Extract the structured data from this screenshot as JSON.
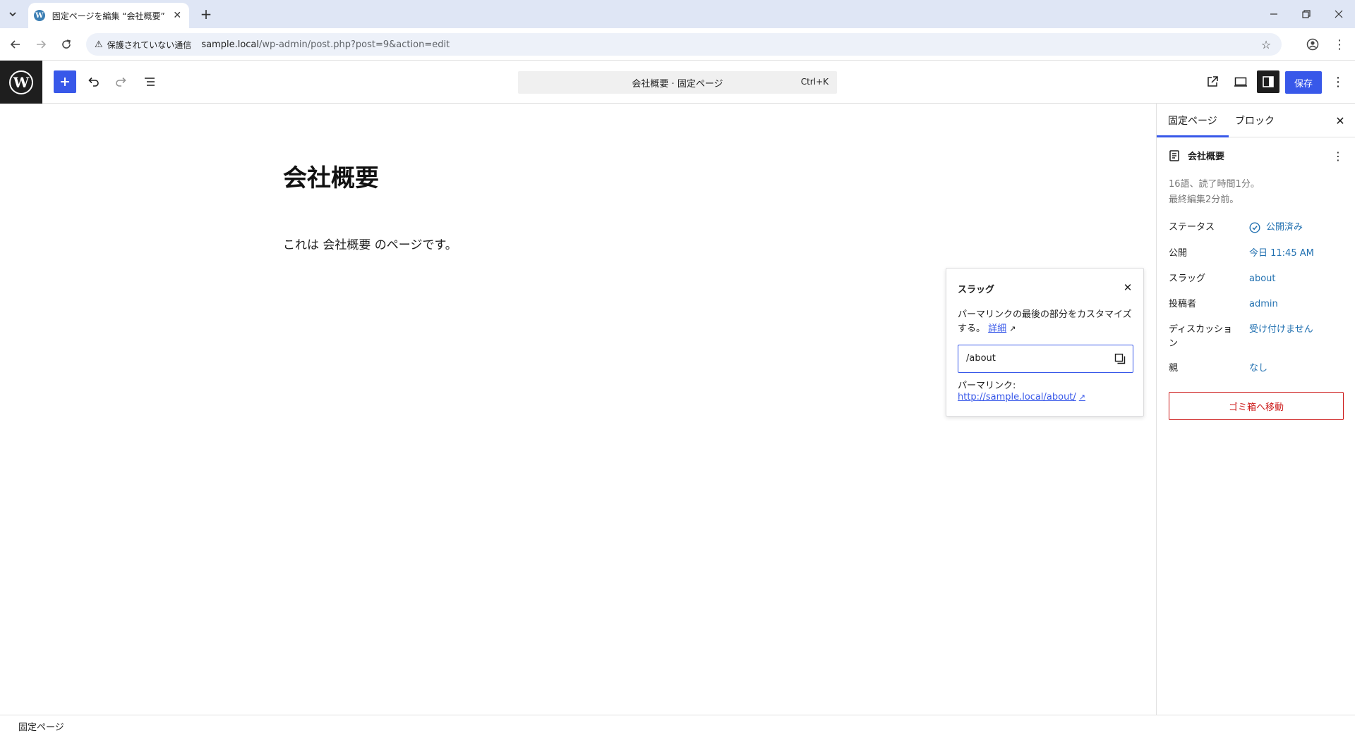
{
  "browser": {
    "tab_title": "固定ページを編集 “会社概要” ‹ サ",
    "security_label": "保護されていない通信",
    "url_host": "sample.local",
    "url_path": "/wp-admin/post.php?post=9&action=edit"
  },
  "editor_header": {
    "doc_title": "会社概要 · 固定ページ",
    "shortcut": "Ctrl+K",
    "save_label": "保存"
  },
  "content": {
    "title": "会社概要",
    "paragraph": "これは 会社概要 のページです。"
  },
  "slug_popover": {
    "title": "スラッグ",
    "description": "パーマリンクの最後の部分をカスタマイズする。",
    "learn_more": "詳細",
    "input_value": "/about",
    "permalink_label": "パーマリンク:",
    "permalink_url": "http://sample.local/about/"
  },
  "sidebar": {
    "tabs": [
      "固定ページ",
      "ブロック"
    ],
    "doc_name": "会社概要",
    "meta_line1": "16語、読了時間1分。",
    "meta_line2": "最終編集2分前。",
    "rows": [
      {
        "label": "ステータス",
        "value": "公開済み"
      },
      {
        "label": "公開",
        "value": "今日 11:45 AM"
      },
      {
        "label": "スラッグ",
        "value": "about"
      },
      {
        "label": "投稿者",
        "value": "admin"
      },
      {
        "label": "ディスカッション",
        "value": "受け付けません"
      },
      {
        "label": "親",
        "value": "なし"
      }
    ],
    "trash_label": "ゴミ箱へ移動"
  },
  "footer": {
    "breadcrumb": "固定ページ"
  },
  "colors": {
    "accent": "#3858e9",
    "link": "#2271b1",
    "danger": "#cc1818",
    "dark": "#1e1e1e"
  }
}
